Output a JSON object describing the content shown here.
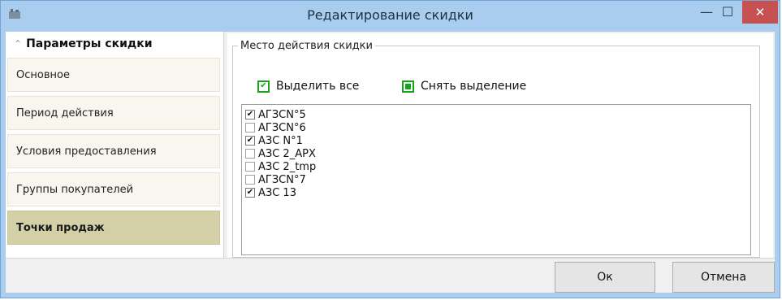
{
  "window": {
    "title": "Редактирование скидки",
    "controls": {
      "minimize": "—",
      "maximize": "☐",
      "close": "✕"
    }
  },
  "sidebar": {
    "header": "Параметры скидки",
    "header_icon": "chevron-double-up-icon",
    "items": [
      {
        "label": "Основное",
        "active": false
      },
      {
        "label": "Период действия",
        "active": false
      },
      {
        "label": "Условия предоставления",
        "active": false
      },
      {
        "label": "Группы покупателей",
        "active": false
      },
      {
        "label": "Точки продаж",
        "active": true
      }
    ]
  },
  "panel": {
    "group_title": "Место действия скидки",
    "select_all": "Выделить все",
    "deselect_all": "Снять выделение",
    "accent_color": "#15a41a",
    "list": [
      {
        "label": "АГЗСN°5",
        "checked": true
      },
      {
        "label": "АГЗСN°6",
        "checked": false
      },
      {
        "label": "АЗС N°1",
        "checked": true
      },
      {
        "label": "АЗС 2_АРХ",
        "checked": false
      },
      {
        "label": "АЗС 2_tmp",
        "checked": false
      },
      {
        "label": "АГЗСN°7",
        "checked": false
      },
      {
        "label": "АЗС 13",
        "checked": true
      }
    ]
  },
  "buttons": {
    "ok": "Ок",
    "cancel": "Отмена"
  }
}
